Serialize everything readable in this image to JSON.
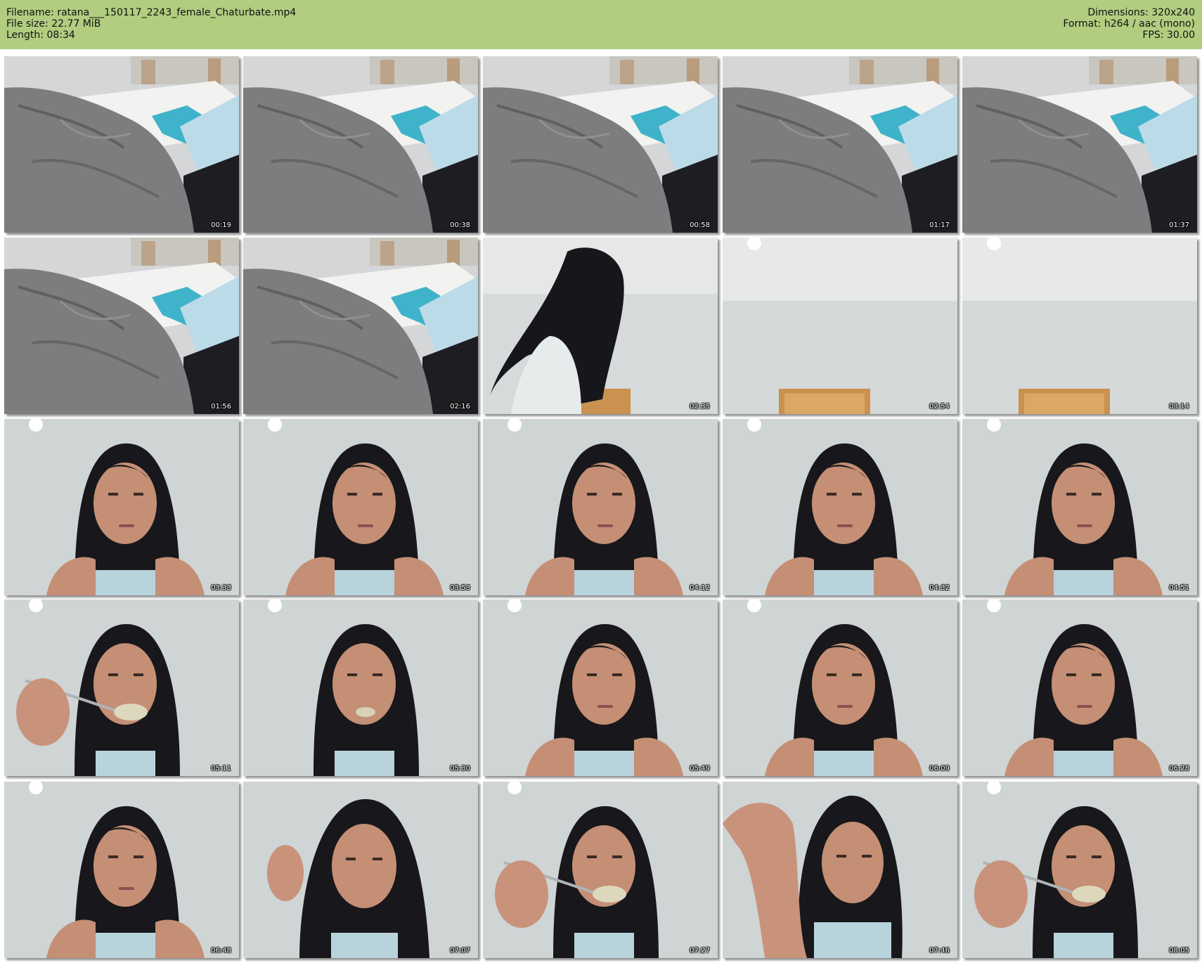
{
  "header": {
    "left": [
      {
        "label": "Filename:",
        "value": "ratana___150117_2243_female_Chaturbate.mp4"
      },
      {
        "label": "File size:",
        "value": "22.77 MiB"
      },
      {
        "label": "Length:",
        "value": "08:34"
      }
    ],
    "right": [
      {
        "label": "Dimensions:",
        "value": "320x240"
      },
      {
        "label": "Format:",
        "value": "h264 / aac (mono)"
      },
      {
        "label": "FPS:",
        "value": "30.00"
      }
    ]
  },
  "colors": {
    "header_bg": "#b0cd80"
  },
  "thumbnails": [
    {
      "time": "00:19",
      "scene": "bed"
    },
    {
      "time": "00:38",
      "scene": "bed"
    },
    {
      "time": "00:58",
      "scene": "bed"
    },
    {
      "time": "01:17",
      "scene": "bed"
    },
    {
      "time": "01:37",
      "scene": "bed"
    },
    {
      "time": "01:56",
      "scene": "bed"
    },
    {
      "time": "02:16",
      "scene": "bed"
    },
    {
      "time": "02:35",
      "scene": "leaning"
    },
    {
      "time": "02:54",
      "scene": "empty-room"
    },
    {
      "time": "03:14",
      "scene": "empty-room"
    },
    {
      "time": "03:33",
      "scene": "face"
    },
    {
      "time": "03:53",
      "scene": "face"
    },
    {
      "time": "04:12",
      "scene": "face"
    },
    {
      "time": "04:32",
      "scene": "face"
    },
    {
      "time": "04:51",
      "scene": "face"
    },
    {
      "time": "05:11",
      "scene": "eating-spoon"
    },
    {
      "time": "05:30",
      "scene": "eating"
    },
    {
      "time": "05:49",
      "scene": "face"
    },
    {
      "time": "06:09",
      "scene": "face"
    },
    {
      "time": "06:28",
      "scene": "face"
    },
    {
      "time": "06:48",
      "scene": "face"
    },
    {
      "time": "07:07",
      "scene": "hand-hair"
    },
    {
      "time": "07:27",
      "scene": "eating-spoon"
    },
    {
      "time": "07:46",
      "scene": "arm-raised"
    },
    {
      "time": "08:05",
      "scene": "eating-spoon"
    }
  ]
}
